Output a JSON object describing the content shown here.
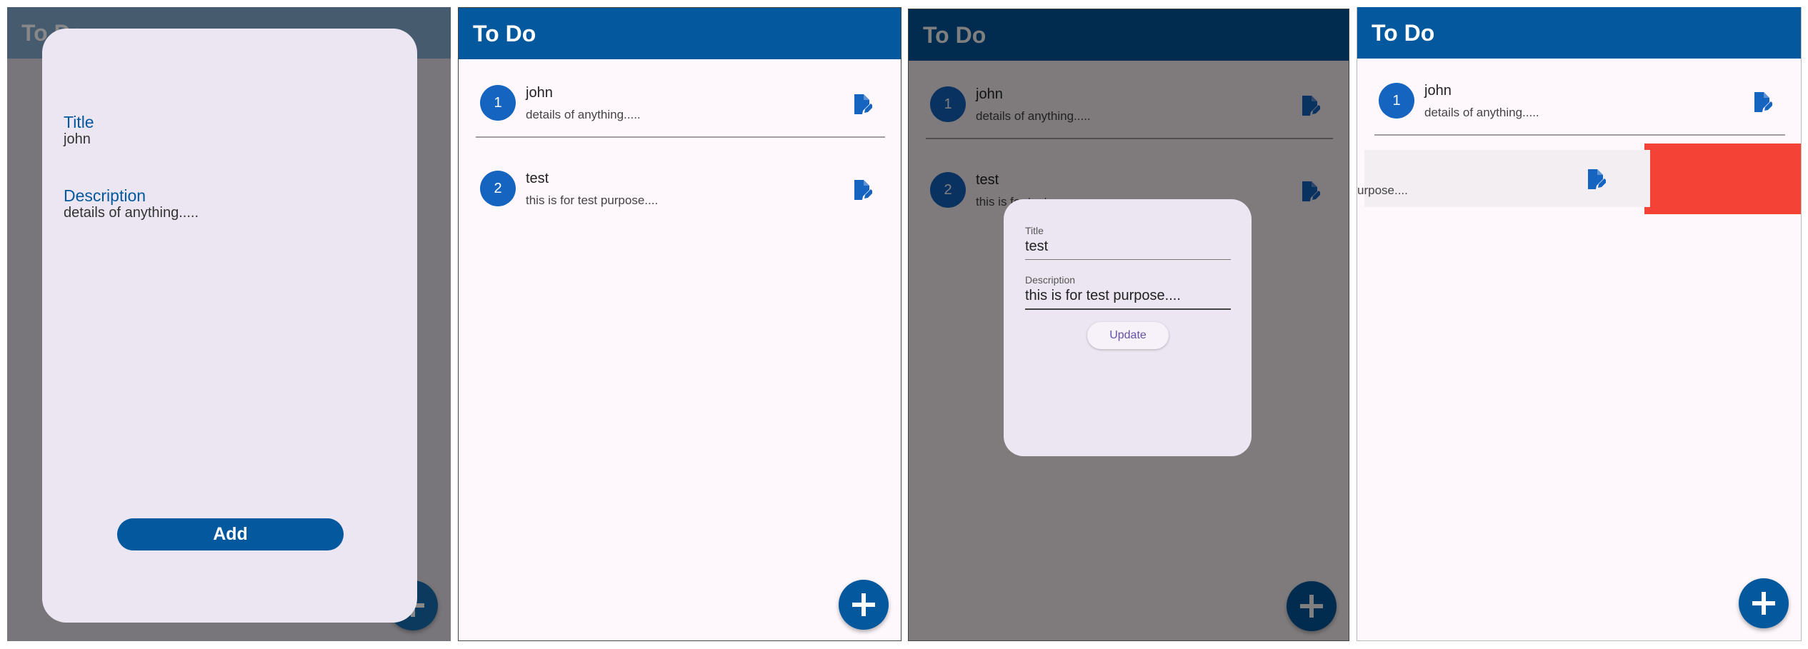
{
  "app": {
    "title": "To Do"
  },
  "todos": [
    {
      "index": "1",
      "title": "john",
      "description": "details of anything....."
    },
    {
      "index": "2",
      "title": "test",
      "description": "this is for test purpose...."
    }
  ],
  "add_sheet": {
    "title_label": "Title",
    "title_value": "john",
    "description_label": "Description",
    "description_value": "details of anything.....",
    "add_button": "Add"
  },
  "edit_dialog": {
    "title_label": "Title",
    "title_value": "test",
    "description_label": "Description",
    "description_value": "this is for test purpose....",
    "update_button": "Update"
  },
  "swipe": {
    "partial_text": "urpose...."
  },
  "icons": {
    "edit": "edit-icon",
    "add": "add-icon"
  },
  "colors": {
    "primary": "#03589e",
    "avatar": "#1565c0",
    "delete": "#f44336",
    "surface": "#ece6f2"
  }
}
